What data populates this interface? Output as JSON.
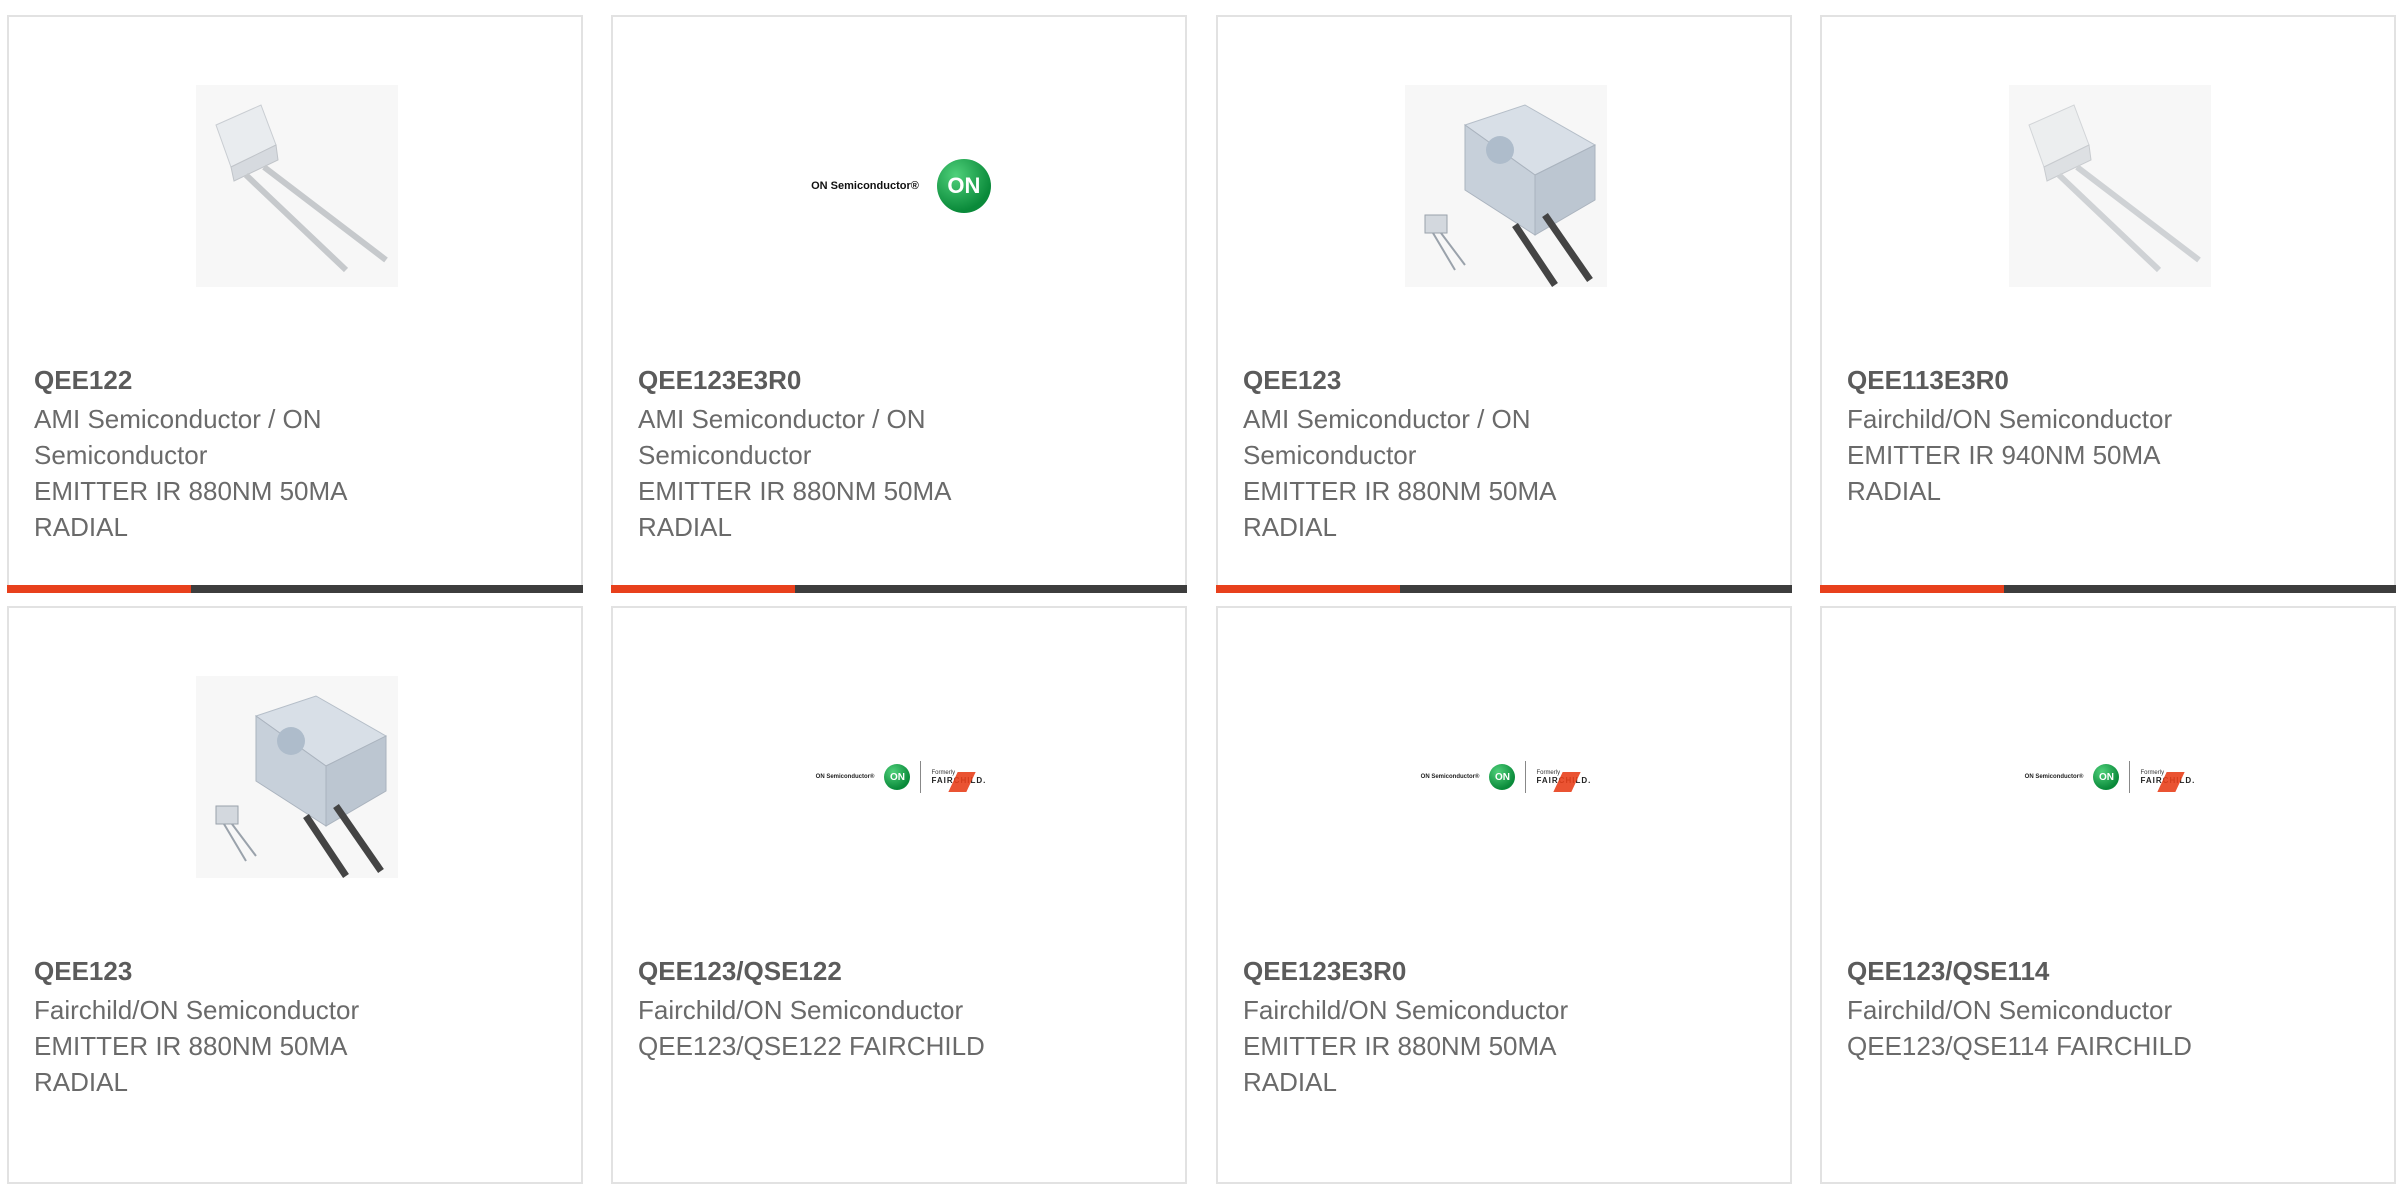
{
  "colors": {
    "accent": "#e8401c",
    "bar": "#3d3d3d",
    "border": "#e2e2e2",
    "text": "#6a6a6a"
  },
  "products": [
    {
      "mpn": "QEE122",
      "manufacturer_lines": [
        "AMI Semiconductor / ON",
        "Semiconductor"
      ],
      "description_lines": [
        "EMITTER IR 880NM 50MA",
        "RADIAL"
      ],
      "image": "ir-emitter-photo"
    },
    {
      "mpn": "QEE123E3R0",
      "manufacturer_lines": [
        "AMI Semiconductor / ON",
        "Semiconductor"
      ],
      "description_lines": [
        "EMITTER IR 880NM 50MA",
        "RADIAL"
      ],
      "image": "on-semiconductor-logo",
      "logo_text": "ON Semiconductor®",
      "logo_badge": "ON"
    },
    {
      "mpn": "QEE123",
      "manufacturer_lines": [
        "AMI Semiconductor / ON",
        "Semiconductor"
      ],
      "description_lines": [
        "EMITTER IR 880NM 50MA",
        "RADIAL"
      ],
      "image": "ir-emitter-block-photo"
    },
    {
      "mpn": "QEE113E3R0",
      "manufacturer_lines": [
        "Fairchild/ON Semiconductor"
      ],
      "description_lines": [
        "EMITTER IR 940NM 50MA",
        "RADIAL"
      ],
      "image": "ir-emitter-photo"
    },
    {
      "mpn": "QEE123",
      "manufacturer_lines": [
        "Fairchild/ON Semiconductor"
      ],
      "description_lines": [
        "EMITTER IR 880NM 50MA",
        "RADIAL"
      ],
      "image": "ir-emitter-block-photo"
    },
    {
      "mpn": "QEE123/QSE122",
      "manufacturer_lines": [
        "Fairchild/ON Semiconductor"
      ],
      "description_lines": [
        "QEE123/QSE122 FAIRCHILD"
      ],
      "image": "on-fairchild-logo",
      "logo_text": "ON Semiconductor®",
      "logo_badge": "ON",
      "logo_formerly": "Formerly",
      "logo_fairchild": "FAIRCHILD."
    },
    {
      "mpn": "QEE123E3R0",
      "manufacturer_lines": [
        "Fairchild/ON Semiconductor"
      ],
      "description_lines": [
        "EMITTER IR 880NM 50MA",
        "RADIAL"
      ],
      "image": "on-fairchild-logo",
      "logo_text": "ON Semiconductor®",
      "logo_badge": "ON",
      "logo_formerly": "Formerly",
      "logo_fairchild": "FAIRCHILD."
    },
    {
      "mpn": "QEE123/QSE114",
      "manufacturer_lines": [
        "Fairchild/ON Semiconductor"
      ],
      "description_lines": [
        "QEE123/QSE114 FAIRCHILD"
      ],
      "image": "on-fairchild-logo",
      "logo_text": "ON Semiconductor®",
      "logo_badge": "ON",
      "logo_formerly": "Formerly",
      "logo_fairchild": "FAIRCHILD."
    }
  ]
}
